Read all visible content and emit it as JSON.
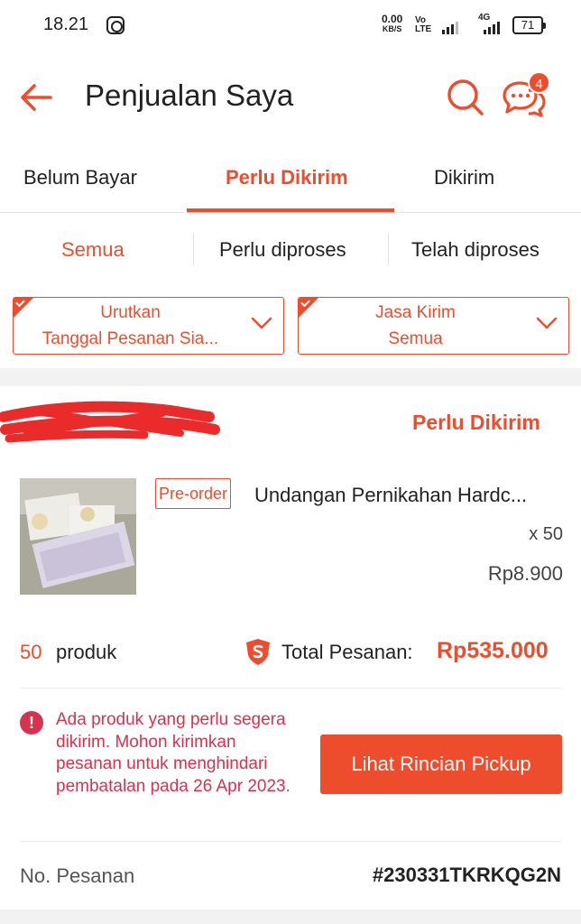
{
  "status_bar": {
    "time": "18.21",
    "data_rate": "0.00",
    "data_unit": "KB/S",
    "volte_top": "Vo",
    "volte_bottom": "LTE",
    "network": "4G",
    "battery": "71"
  },
  "header": {
    "title": "Penjualan Saya",
    "notification_count": "4"
  },
  "tabs": [
    {
      "label": "Belum Bayar",
      "active": false
    },
    {
      "label": "Perlu Dikirim",
      "active": true
    },
    {
      "label": "Dikirim",
      "active": false
    }
  ],
  "subtabs": [
    {
      "label": "Semua",
      "active": true
    },
    {
      "label": "Perlu diproses",
      "active": false
    },
    {
      "label": "Telah diproses",
      "active": false
    }
  ],
  "filters": {
    "sort": {
      "title": "Urutkan",
      "value": "Tanggal Pesanan Sia..."
    },
    "courier": {
      "title": "Jasa Kirim",
      "value": "Semua"
    }
  },
  "order": {
    "status": "Perlu Dikirim",
    "product": {
      "tag": "Pre-order",
      "name": "Undangan Pernikahan Hardc...",
      "quantity": "x 50",
      "price": "Rp8.900"
    },
    "product_count": "50",
    "product_count_label": "produk",
    "total_label": "Total Pesanan:",
    "total_value": "Rp535.000",
    "alert": "Ada produk yang perlu segera dikirim. Mohon kirimkan pesanan untuk menghindari pembatalan pada 26 Apr 2023.",
    "pickup_button": "Lihat Rincian Pickup",
    "order_number_label": "No. Pesanan",
    "order_number": "#230331TKRKQG2N"
  },
  "colors": {
    "accent": "#ee4d2d",
    "alert": "#d8324f",
    "background_gray": "#f2f2f2"
  },
  "icons": [
    "back-arrow-icon",
    "search-icon",
    "chat-icon",
    "chevron-down-icon",
    "shield-icon",
    "alert-icon"
  ]
}
